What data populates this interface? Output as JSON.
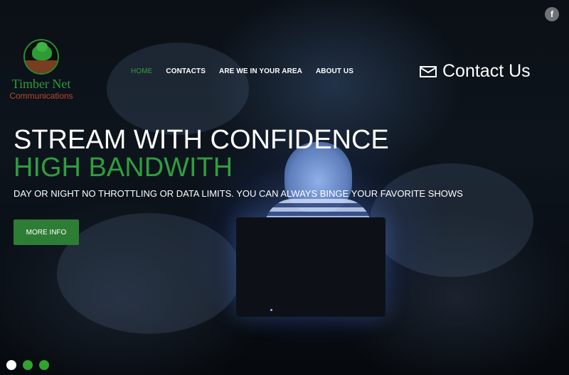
{
  "brand": {
    "name": "Timber Net",
    "subtitle": "Communications",
    "green": "#2f9e3e",
    "orange": "#b84a2d"
  },
  "social": {
    "facebook_icon": "f"
  },
  "nav": {
    "items": [
      {
        "label": "HOME",
        "active": true
      },
      {
        "label": "CONTACTS"
      },
      {
        "label": "ARE WE IN YOUR AREA"
      },
      {
        "label": "ABOUT US"
      }
    ]
  },
  "contact": {
    "label": "Contact Us",
    "icon": "envelope-icon"
  },
  "hero": {
    "headline": "STREAM WITH CONFIDENCE",
    "subhead": "HIGH BANDWITH",
    "tagline": "DAY OR NIGHT NO THROTTLING OR DATA LIMITS. YOU CAN ALWAYS BINGE YOUR FAVORITE SHOWS",
    "button_label": "MORE INFO"
  },
  "slider": {
    "count": 3,
    "current": 1
  }
}
